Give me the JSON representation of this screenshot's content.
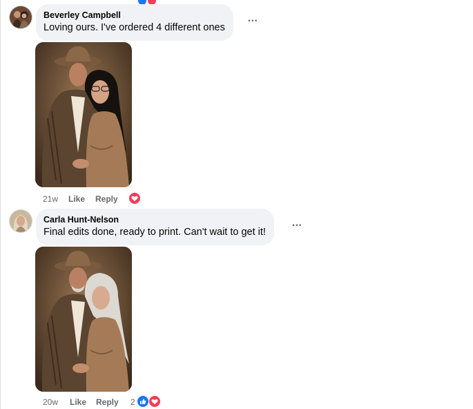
{
  "comments": [
    {
      "author": "Beverley Campbell",
      "text": "Loving ours. I've ordered 4 different ones",
      "time": "21w",
      "like_label": "Like",
      "reply_label": "Reply",
      "reaction_count": "",
      "reactions": [
        "love-icon"
      ],
      "photo": "western-couple-portrait-dark-hair"
    },
    {
      "author": "Carla Hunt-Nelson",
      "text": "Final edits done, ready to print. Can't wait to get it!",
      "time": "20w",
      "like_label": "Like",
      "reply_label": "Reply",
      "reaction_count": "2",
      "reactions": [
        "like-icon",
        "love-icon"
      ],
      "photo": "western-couple-portrait-gray-hair"
    }
  ],
  "colors": {
    "bubble_bg": "#f0f2f5",
    "secondary_text": "#65676b",
    "like_blue": "#1877f2",
    "love_red": "#f33e58"
  }
}
